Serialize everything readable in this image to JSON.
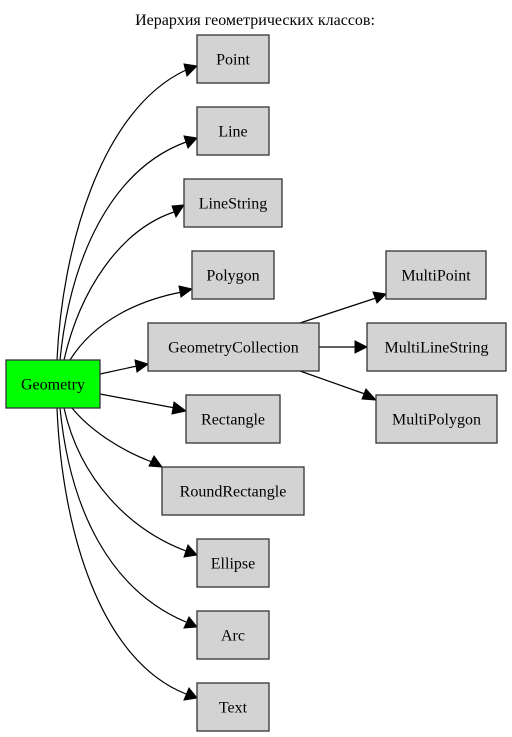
{
  "title": "Иерархия геометрических классов:",
  "colors": {
    "root_fill": "#00ff00",
    "node_fill": "#d3d3d3",
    "border": "#333333",
    "edge": "#000000"
  },
  "nodes": [
    {
      "id": "Geometry",
      "label": "Geometry",
      "root": true
    },
    {
      "id": "Point",
      "label": "Point"
    },
    {
      "id": "Line",
      "label": "Line"
    },
    {
      "id": "LineString",
      "label": "LineString"
    },
    {
      "id": "Polygon",
      "label": "Polygon"
    },
    {
      "id": "GeometryCollection",
      "label": "GeometryCollection"
    },
    {
      "id": "Rectangle",
      "label": "Rectangle"
    },
    {
      "id": "RoundRectangle",
      "label": "RoundRectangle"
    },
    {
      "id": "Ellipse",
      "label": "Ellipse"
    },
    {
      "id": "Arc",
      "label": "Arc"
    },
    {
      "id": "Text",
      "label": "Text"
    },
    {
      "id": "MultiPoint",
      "label": "MultiPoint"
    },
    {
      "id": "MultiLineString",
      "label": "MultiLineString"
    },
    {
      "id": "MultiPolygon",
      "label": "MultiPolygon"
    }
  ],
  "edges": [
    {
      "from": "Geometry",
      "to": "Point"
    },
    {
      "from": "Geometry",
      "to": "Line"
    },
    {
      "from": "Geometry",
      "to": "LineString"
    },
    {
      "from": "Geometry",
      "to": "Polygon"
    },
    {
      "from": "Geometry",
      "to": "GeometryCollection"
    },
    {
      "from": "Geometry",
      "to": "Rectangle"
    },
    {
      "from": "Geometry",
      "to": "RoundRectangle"
    },
    {
      "from": "Geometry",
      "to": "Ellipse"
    },
    {
      "from": "Geometry",
      "to": "Arc"
    },
    {
      "from": "Geometry",
      "to": "Text"
    },
    {
      "from": "GeometryCollection",
      "to": "MultiPoint"
    },
    {
      "from": "GeometryCollection",
      "to": "MultiLineString"
    },
    {
      "from": "GeometryCollection",
      "to": "MultiPolygon"
    }
  ]
}
